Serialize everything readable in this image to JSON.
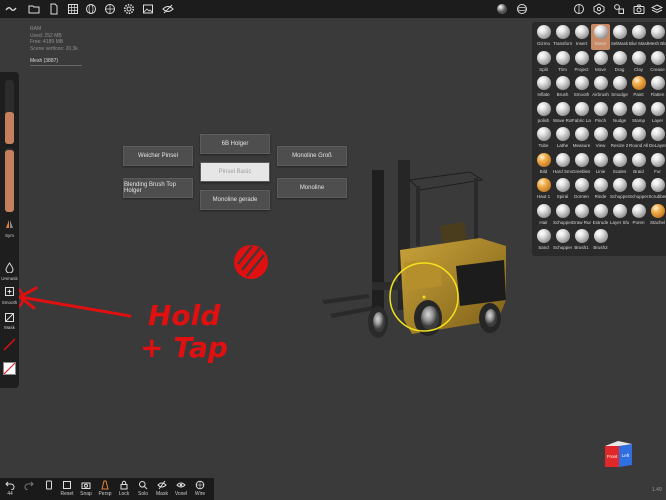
{
  "stats": {
    "ram_label": "RAM",
    "used": "Used: 252 MB",
    "free": "Free: 4189 MB",
    "scene_vertices": "Scene vertices: 20.3k"
  },
  "mesh": {
    "label": "Mesh (3887)"
  },
  "topbar": {
    "icons": [
      "menu-logo-icon",
      "folder-icon",
      "file-icon",
      "download-icon",
      "grid-icon",
      "globe-icon",
      "gear-icon",
      "image-icon",
      "eye-off-icon",
      "shading-sphere-icon",
      "sphere-icon",
      "material-icon",
      "settings-icon",
      "shapes-icon",
      "camera-icon"
    ]
  },
  "left_bar": {
    "sym_label": "Sym",
    "unmask_label": "Unmask",
    "smooth_label": "Smooth",
    "mask_label": "Mask",
    "slider_colors": {
      "fill": "#c4805c"
    }
  },
  "bottom_bar": {
    "undo_count": "44",
    "items": [
      {
        "icon": "box-icon",
        "label": "Reset"
      },
      {
        "icon": "camera-icon",
        "label": "Snap"
      },
      {
        "icon": "perspective-icon",
        "label": "Persp"
      },
      {
        "icon": "lock-icon",
        "label": "Lock"
      },
      {
        "icon": "search-icon",
        "label": "Solo"
      },
      {
        "icon": "mask-eye-icon",
        "label": "Mask"
      },
      {
        "icon": "voxel-icon",
        "label": "Voxel"
      },
      {
        "icon": "wire-icon",
        "label": "Wire"
      }
    ]
  },
  "tools": [
    [
      "Gizmo",
      "Transform",
      "Insert",
      "Move",
      "SelMask",
      "Blur Mask",
      "Mesh Blend"
    ],
    [
      "Split",
      "Trim",
      "Project",
      "Move",
      "Drag",
      "Clay",
      "Crease"
    ],
    [
      "Inflate",
      "Brush",
      "Smooth",
      "Airbrush",
      "Smudge",
      "Paint",
      "Flatten"
    ],
    [
      "polish",
      "Wave Rotor",
      "Fabric Lace",
      "Pinch",
      "Nudge",
      "Stamp",
      "Layer"
    ],
    [
      "Tube",
      "Lathe",
      "Measure",
      "View",
      "Resize 2",
      "Round All",
      "DeLayer"
    ],
    [
      "Bild",
      "Hard Smooth",
      "Greebles Mask",
      "Linie",
      "Scales",
      "Braid",
      "Fur"
    ],
    [
      "Haut 1",
      "Spiral",
      "Dornen",
      "Rinde",
      "Schuppen 1",
      "Schuppen Kraft",
      "Scrubber"
    ],
    [
      "Hair",
      "Schuppen 3",
      "Draw Runner Blob",
      "Extrude",
      "Layer Sharp",
      "Poren",
      "Stachel"
    ],
    [
      "Sand",
      "Schuppen 4",
      "Brush1",
      "Brush2"
    ]
  ],
  "brush_menu": {
    "items": {
      "top": "6B Holger",
      "left_top": "Weicher Pinsel",
      "center": "Pinsel Basic",
      "right_top": "Monoline Groß",
      "left_bottom": "Blending Brush Top Holger",
      "right_bottom": "Monoline",
      "bottom": "Monoline gerade"
    }
  },
  "annotation": {
    "line1": "Hold",
    "line2": "+ Tap",
    "color": "#e01010"
  },
  "view_cube": {
    "front": "Front",
    "left": "Left"
  },
  "fps": "1.49"
}
